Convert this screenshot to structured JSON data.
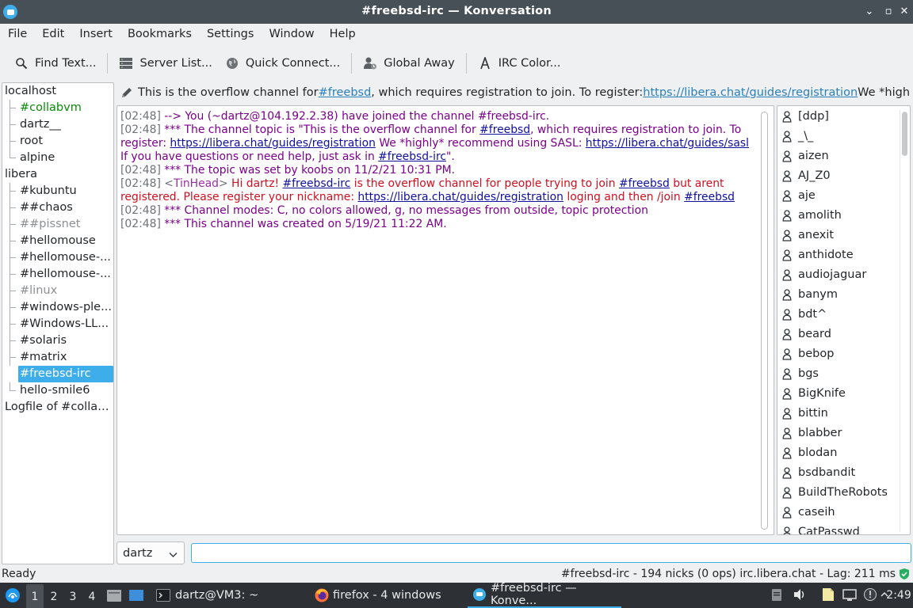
{
  "window": {
    "title": "#freebsd-irc — Konversation"
  },
  "menubar": [
    "File",
    "Edit",
    "Insert",
    "Bookmarks",
    "Settings",
    "Window",
    "Help"
  ],
  "toolbar": {
    "find_text": "Find Text...",
    "server_list": "Server List...",
    "quick_connect": "Quick Connect...",
    "global_away": "Global Away",
    "irc_color": "IRC Color..."
  },
  "tree": [
    {
      "label": "localhost",
      "level": 0
    },
    {
      "label": "#collabvm",
      "level": 1,
      "style": "green"
    },
    {
      "label": "dartz__",
      "level": 1
    },
    {
      "label": "root",
      "level": 1
    },
    {
      "label": "alpine",
      "level": 1,
      "last": true
    },
    {
      "label": "libera",
      "level": 0
    },
    {
      "label": "#kubuntu",
      "level": 1
    },
    {
      "label": "##chaos",
      "level": 1
    },
    {
      "label": "##pissnet",
      "level": 1,
      "style": "gray"
    },
    {
      "label": "#hellomouse",
      "level": 1
    },
    {
      "label": "#hellomouse-...",
      "level": 1
    },
    {
      "label": "#hellomouse-...",
      "level": 1
    },
    {
      "label": "#linux",
      "level": 1,
      "style": "gray"
    },
    {
      "label": "#windows-ple...",
      "level": 1
    },
    {
      "label": "#Windows-LL...",
      "level": 1
    },
    {
      "label": "#solaris",
      "level": 1
    },
    {
      "label": "#matrix",
      "level": 1
    },
    {
      "label": "#freebsd-irc",
      "level": 1,
      "selected": true
    },
    {
      "label": "hello-smile6",
      "level": 1,
      "last": true
    },
    {
      "label": "Logfile of #collab...",
      "level": 0
    }
  ],
  "topic": {
    "before": "This is the overflow channel for ",
    "channel": "#freebsd",
    "middle": ", which requires registration to join. To register: ",
    "url": "https://libera.chat/guides/registration",
    "after": " We *highly*..."
  },
  "chat": {
    "l1_ts": "[02:48]",
    "l1_text": " --> You (~dartz@104.192.2.38) have joined the channel #freebsd-irc.",
    "l2_ts": "[02:48]",
    "l2_a": " *** The channel topic is \"This is the overflow channel for ",
    "l2_link1": "#freebsd",
    "l2_b": ", which requires registration to join. To register: ",
    "l2_link2": "https://libera.chat/guides/registration",
    "l2_c": " We *highly* recommend using SASL: ",
    "l2_link3": "https://libera.chat/guides/sasl",
    "l2_d": " If you have questions or need help, just ask in ",
    "l2_link4": "#freebsd-irc",
    "l2_e": "\".",
    "l3_ts": "[02:48]",
    "l3_text": " *** The topic was set by koobs on 11/2/21 10:31 PM.",
    "l4_ts": "[02:48]",
    "l4_open": " <",
    "l4_nick": "TinHead",
    "l4_close": "> ",
    "l4_a": "Hi dartz! ",
    "l4_link1": "#freebsd-irc",
    "l4_b": " is the overflow channel for people trying to join ",
    "l4_link2": "#freebsd",
    "l4_c": " but arent registered. Please register your nickname: ",
    "l4_link3": "https://libera.chat/guides/registration",
    "l4_d": " loging and then /join ",
    "l4_link4": "#freebsd",
    "l5_ts": "[02:48]",
    "l5_text": " *** Channel modes: C, no colors allowed, g, no messages from outside, topic protection",
    "l6_ts": "[02:48]",
    "l6_text": " *** This channel was created on 5/19/21 11:22 AM."
  },
  "nicks": [
    "[ddp]",
    "_\\_",
    "aizen",
    "AJ_Z0",
    "aje",
    "amolith",
    "anexit",
    "anthidote",
    "audiojaguar",
    "banym",
    "bdt^",
    "beard",
    "bebop",
    "bgs",
    "BigKnife",
    "bittin",
    "blabber",
    "blodan",
    "bsdbandit",
    "BuildTheRobots",
    "caseih",
    "CatPasswd"
  ],
  "input": {
    "nick": "dartz",
    "message": ""
  },
  "status": {
    "left": "Ready",
    "right": "#freebsd-irc - 194 nicks (0 ops)  irc.libera.chat - Lag: 211 ms"
  },
  "taskbar": {
    "desktops": [
      "1",
      "2",
      "3",
      "4"
    ],
    "terminal": "dartz@VM3: ~",
    "firefox": "firefox - 4 windows",
    "konversation": "#freebsd-irc — Konve...",
    "clock": "2:49"
  },
  "colors": {
    "accent": "#3daee9",
    "titlebar": "#475057",
    "taskbar": "#2d3135",
    "chat_purple": "#7b008b",
    "chat_red": "#d01020",
    "link": "#1010a0",
    "green": "#0a8a0a"
  }
}
